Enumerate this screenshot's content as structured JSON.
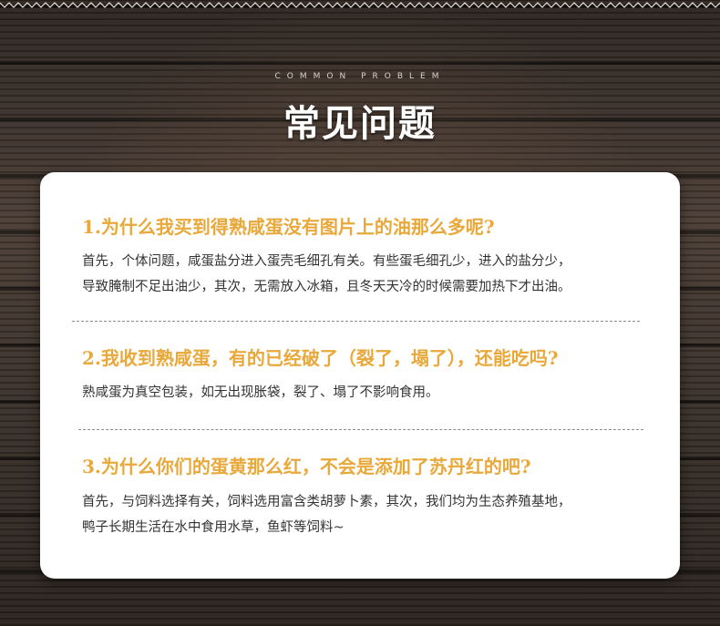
{
  "header": {
    "subtitle": "COMMON PROBLEM",
    "title": "常见问题"
  },
  "faq": [
    {
      "question": "1.为什么我买到得熟咸蛋没有图片上的油那么多呢?",
      "answer_lines": [
        "首先，个体问题，咸蛋盐分进入蛋壳毛细孔有关。有些蛋毛细孔少，进入的盐分少，",
        "导致腌制不足出油少，其次，无需放入冰箱，且冬天天冷的时候需要加热下才出油。"
      ]
    },
    {
      "question": "2.我收到熟咸蛋，有的已经破了（裂了，塌了），还能吃吗?",
      "answer_lines": [
        "熟咸蛋为真空包装，如无出现胀袋，裂了、塌了不影响食用。"
      ]
    },
    {
      "question": "3.为什么你们的蛋黄那么红，不会是添加了苏丹红的吧?",
      "answer_lines": [
        "首先，与饲料选择有关，饲料选用富含类胡萝卜素，其次，我们均为生态养殖基地，",
        "鸭子长期生活在水中食用水草，鱼虾等饲料~"
      ]
    }
  ],
  "colors": {
    "question_accent": "#e9a83a",
    "answer_text": "#333333",
    "card_bg": "#ffffff"
  }
}
